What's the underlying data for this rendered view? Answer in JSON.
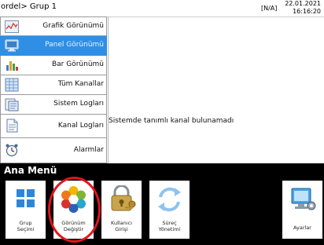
{
  "header": {
    "breadcrumb": "ordel> Grup 1",
    "status": "[N/A]",
    "date": "22.01.2021",
    "time": "16:16:20"
  },
  "sidebar": {
    "active_color": "#2f8fe6",
    "items": [
      {
        "label": "Grafik Görünümü",
        "icon": "line-chart-icon",
        "active": false
      },
      {
        "label": "Panel Görünümü",
        "icon": "monitor-icon",
        "active": true
      },
      {
        "label": "Bar Görünümü",
        "icon": "bar-chart-icon",
        "active": false
      },
      {
        "label": "Tüm Kanallar",
        "icon": "table-grid-icon",
        "active": false
      },
      {
        "label": "Sistem Logları",
        "icon": "system-log-icon",
        "active": false
      },
      {
        "label": "Kanal Logları",
        "icon": "document-icon",
        "active": false
      },
      {
        "label": "Alarmlar",
        "icon": "alarm-clock-icon",
        "active": false
      }
    ]
  },
  "main": {
    "message": "Sistemde tanımlı kanal bulunamadı"
  },
  "menu": {
    "title": "Ana Menü",
    "highlight_color": "#e3141e",
    "tiles": [
      {
        "label_line1": "Grup",
        "label_line2": "Seçimi",
        "icon": "grid-squares-icon"
      },
      {
        "label_line1": "Görünüm",
        "label_line2": "Değiştir",
        "icon": "color-hexagon-icon"
      },
      {
        "label_line1": "Kullanıcı",
        "label_line2": "Girişi",
        "icon": "lock-keys-icon"
      },
      {
        "label_line1": "Süreç",
        "label_line2": "Yönetimi",
        "icon": "refresh-arrows-icon"
      },
      {
        "label_line1": "Ayarlar",
        "label_line2": "",
        "icon": "settings-monitor-icon"
      }
    ]
  }
}
